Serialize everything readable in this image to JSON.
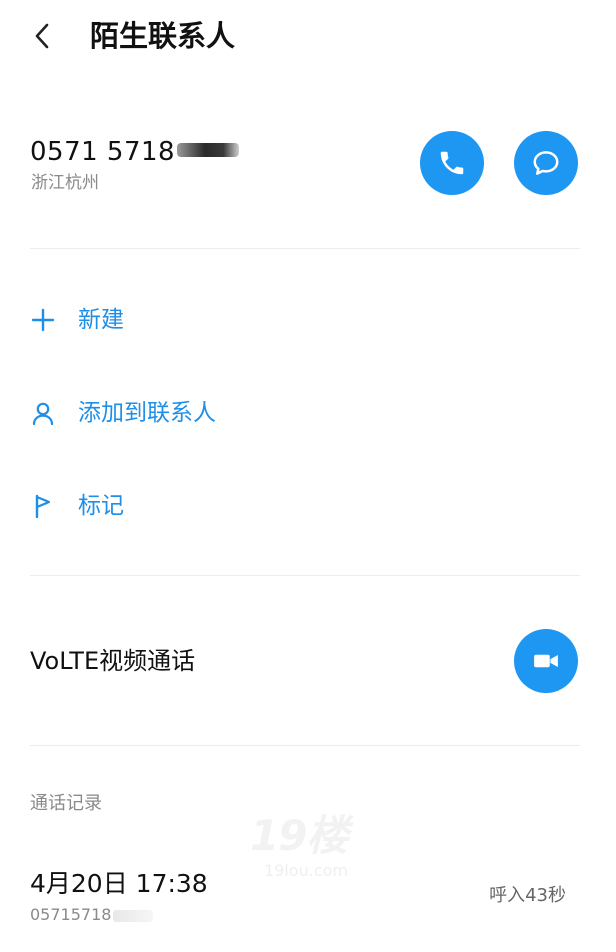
{
  "header": {
    "back_icon": "chevron-left-icon",
    "title": "陌生联系人"
  },
  "contact": {
    "number_visible": "0571 5718",
    "location": "浙江杭州",
    "call_icon": "phone-icon",
    "message_icon": "message-icon"
  },
  "actions": [
    {
      "icon": "plus-icon",
      "label": "新建"
    },
    {
      "icon": "person-icon",
      "label": "添加到联系人"
    },
    {
      "icon": "flag-icon",
      "label": "标记"
    }
  ],
  "volte": {
    "label": "VoLTE视频通话",
    "icon": "video-camera-icon"
  },
  "call_log": {
    "section_title": "通话记录",
    "date_time": "4月20日 17:38",
    "number_visible": "05715718",
    "duration": "呼入43秒"
  },
  "watermark": {
    "main": "19楼",
    "sub": "19lou.com"
  },
  "colors": {
    "accent": "#1e97f3",
    "accent_text": "#1e8fe8",
    "secondary_text": "#8a8a8a",
    "divider": "#ececec"
  }
}
